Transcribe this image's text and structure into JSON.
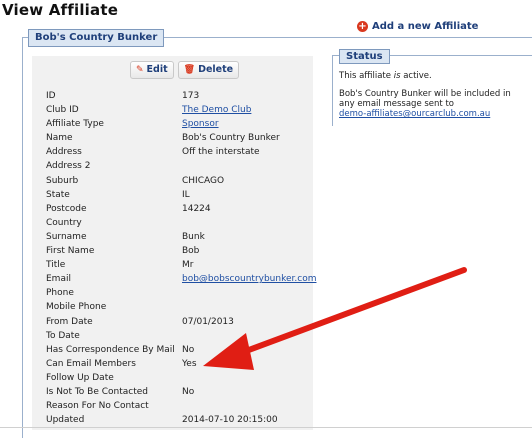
{
  "page": {
    "title": "View Affiliate"
  },
  "actions": {
    "add_affiliate": "Add a new Affiliate",
    "edit": "Edit",
    "delete": "Delete"
  },
  "record": {
    "name": "Bob's Country Bunker"
  },
  "fields": [
    {
      "label": "ID",
      "value": "173"
    },
    {
      "label": "Club ID",
      "value": "The Demo Club",
      "link": true
    },
    {
      "label": "Affiliate Type",
      "value": "Sponsor",
      "link": true
    },
    {
      "label": "Name",
      "value": "Bob's Country Bunker"
    },
    {
      "label": "Address",
      "value": "Off the interstate"
    },
    {
      "label": "Address 2",
      "value": ""
    },
    {
      "label": "Suburb",
      "value": "CHICAGO"
    },
    {
      "label": "State",
      "value": "IL"
    },
    {
      "label": "Postcode",
      "value": "14224"
    },
    {
      "label": "Country",
      "value": ""
    },
    {
      "label": "Surname",
      "value": "Bunk"
    },
    {
      "label": "First Name",
      "value": "Bob"
    },
    {
      "label": "Title",
      "value": "Mr"
    },
    {
      "label": "Email",
      "value": "bob@bobscountrybunker.com",
      "link": true
    },
    {
      "label": "Phone",
      "value": ""
    },
    {
      "label": "Mobile Phone",
      "value": ""
    },
    {
      "label": "From Date",
      "value": "07/01/2013"
    },
    {
      "label": "To Date",
      "value": ""
    },
    {
      "label": "Has Correspondence By Mail",
      "value": "No"
    },
    {
      "label": "Can Email Members",
      "value": "Yes"
    },
    {
      "label": "Follow Up Date",
      "value": ""
    },
    {
      "label": "Is Not To Be Contacted",
      "value": "No"
    },
    {
      "label": "Reason For No Contact",
      "value": ""
    },
    {
      "label": "Updated",
      "value": "2014-07-10 20:15:00"
    }
  ],
  "status": {
    "title": "Status",
    "active_prefix": "This affiliate ",
    "active_word": "is",
    "active_suffix": " active.",
    "email_note": "Bob's Country Bunker will be included in any email message sent to",
    "email_link": "demo-affiliates@ourcarclub.com.au"
  },
  "colors": {
    "accent": "#1f3f7a",
    "arrow": "#e01e14",
    "panel": "#f1f1f1"
  }
}
